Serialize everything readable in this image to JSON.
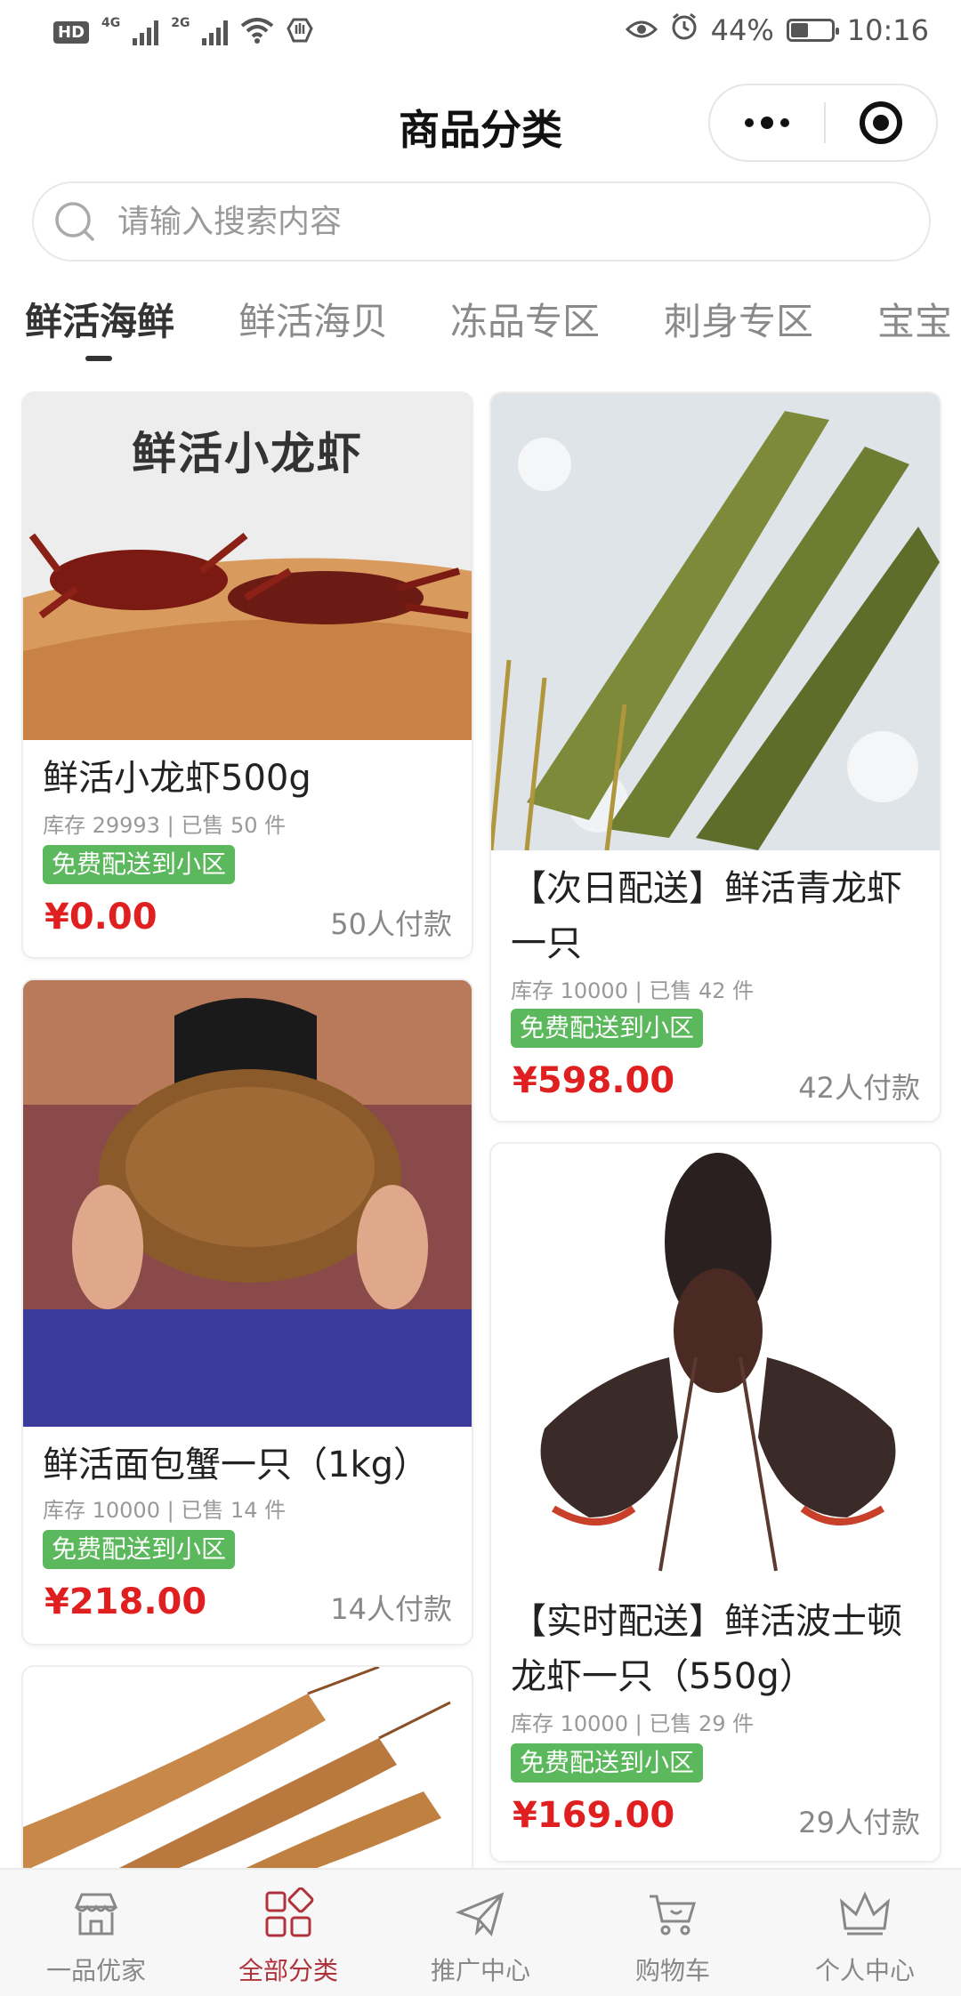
{
  "status_bar": {
    "hd": "HD",
    "net1": "4G",
    "net2": "2G",
    "battery_percent": "44%",
    "battery_level": 0.44,
    "time": "10:16"
  },
  "nav": {
    "title": "商品分类"
  },
  "search": {
    "placeholder": "请输入搜索内容"
  },
  "tabs": [
    {
      "label": "鲜活海鲜",
      "active": true
    },
    {
      "label": "鲜活海贝",
      "active": false
    },
    {
      "label": "冻品专区",
      "active": false
    },
    {
      "label": "刺身专区",
      "active": false
    },
    {
      "label": "宝宝",
      "active": false
    }
  ],
  "products": [
    {
      "image_text": "鲜活小龙虾",
      "name": "鲜活小龙虾500g",
      "stock": "库存 29993 | 已售 50 件",
      "badge": "免费配送到小区",
      "price": "¥0.00",
      "paid": "50人付款"
    },
    {
      "name": "【次日配送】鲜活青龙虾一只",
      "stock": "库存 10000 | 已售 42 件",
      "badge": "免费配送到小区",
      "price": "¥598.00",
      "paid": "42人付款"
    },
    {
      "name": "鲜活面包蟹一只（1kg）",
      "stock": "库存 10000 | 已售 14 件",
      "badge": "免费配送到小区",
      "price": "¥218.00",
      "paid": "14人付款"
    },
    {
      "name": "【实时配送】鲜活波士顿龙虾一只（550g）",
      "stock": "库存 10000 | 已售 29 件",
      "badge": "免费配送到小区",
      "price": "¥169.00",
      "paid": "29人付款"
    }
  ],
  "tabbar": [
    {
      "label": "一品优家",
      "icon": "shop-icon",
      "active": false
    },
    {
      "label": "全部分类",
      "icon": "grid-icon",
      "active": true
    },
    {
      "label": "推广中心",
      "icon": "send-icon",
      "active": false
    },
    {
      "label": "购物车",
      "icon": "cart-icon",
      "active": false
    },
    {
      "label": "个人中心",
      "icon": "crown-icon",
      "active": false
    }
  ],
  "colors": {
    "price": "#e02020",
    "badge": "#5cb85c",
    "tab_active": "#b0333c"
  }
}
